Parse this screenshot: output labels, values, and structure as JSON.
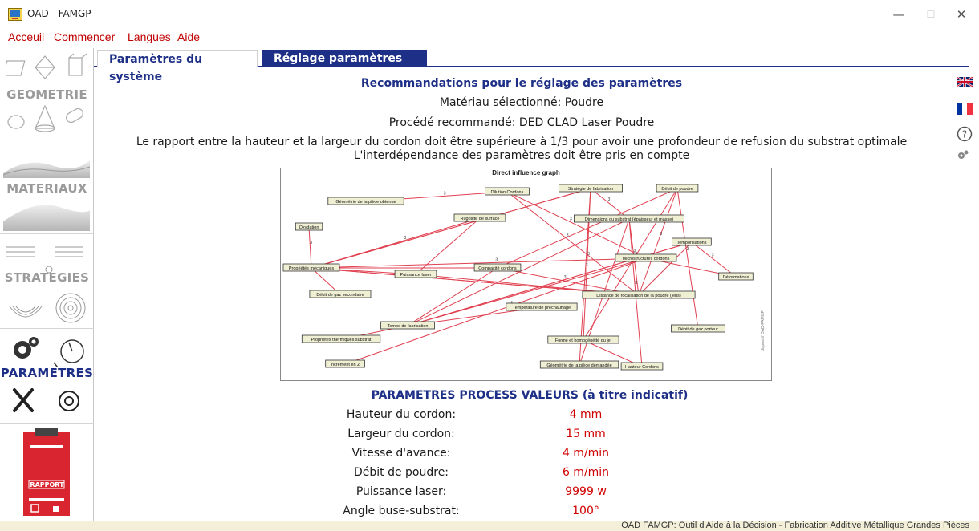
{
  "window": {
    "title": "OAD - FAMGP",
    "minimize_glyph": "—",
    "maximize_glyph": "☐",
    "close_glyph": "✕"
  },
  "menu": {
    "items": [
      "Acceuil",
      "Commencer",
      "Langues",
      "Aide"
    ]
  },
  "sidebar": {
    "sections": [
      {
        "label": "GEOMETRIE",
        "state": "inactive"
      },
      {
        "label": "MATERIAUX",
        "state": "inactive"
      },
      {
        "label": "STRATEGIES",
        "state": "inactive"
      },
      {
        "label": "PARAMETRES",
        "state": "active"
      },
      {
        "label": "RAPPORT",
        "state": "inactive"
      }
    ]
  },
  "tabs": [
    {
      "label": "Paramètres du système",
      "active": false
    },
    {
      "label": "Réglage paramètres",
      "active": true
    }
  ],
  "right_icons": [
    "uk-flag-icon",
    "france-flag-icon",
    "help-icon",
    "gear-cog-icon"
  ],
  "content": {
    "title": "Recommandations pour le réglage des paramètres",
    "material_line": "Matériau sélectionné: Poudre",
    "process_line": "Procédé recommandé: DED CLAD Laser Poudre",
    "ratio_line": "Le rapport entre la hauteur et la largeur du cordon doit être supérieure à 1/3 pour avoir une profondeur de refusion du substrat optimale",
    "interdependence_line": "L'interdépendance des paramètres doit être pris en compte"
  },
  "graph": {
    "title": "Direct influence graph",
    "side_text": "dispositif OAD-FAMGP",
    "nodes": [
      "Géométrie de la pièce obtenue",
      "Dilution Cordons",
      "Stratégie de fabrication",
      "Débit de poudre",
      "Rugosité de surface",
      "Dimensions du substrat (épaisseur et masse)",
      "Oxydation",
      "Temporisations",
      "Microstructures cordons",
      "Propriétés mécaniques",
      "Puissance laser",
      "Compacité cordons",
      "Déformations",
      "Débit de gaz secondaire",
      "Distance de focalisation de la poudre (lens)",
      "Température de préchauffage",
      "Temps de fabrication",
      "Débit de gaz porteur",
      "Propriétés thermiques substrat",
      "Forme et homogénéité du jet",
      "Incrément en Z",
      "Géométrie de la pièce demandée",
      "Hauteur Cordons"
    ],
    "edge_weight_labels": [
      "3",
      "3",
      "3",
      "3",
      "3",
      "3",
      "3",
      "3",
      "3",
      "3",
      "3",
      "3",
      "3",
      "3",
      "3",
      "3",
      "3",
      "3"
    ],
    "edge_color": "#e04050"
  },
  "params": {
    "title": "PARAMETRES PROCESS VALEURS (à titre indicatif)",
    "rows": [
      {
        "label": "Hauteur du cordon:",
        "value": "4 mm"
      },
      {
        "label": "Largeur du cordon:",
        "value": "15 mm"
      },
      {
        "label": "Vitesse d'avance:",
        "value": "4 m/min"
      },
      {
        "label": "Débit de poudre:",
        "value": "6 m/min"
      },
      {
        "label": "Puissance laser:",
        "value": "9999 w"
      },
      {
        "label": "Angle buse-substrat:",
        "value": "100°"
      }
    ]
  },
  "status": {
    "text": "OAD FAMGP: Outil d'Aide à la Décision - Fabrication Additive Métallique Grandes Pièces"
  },
  "colors": {
    "accent_blue": "#1d2f86",
    "menu_red": "#c00000",
    "value_red": "#d00000",
    "status_bg": "#f3efd9"
  }
}
